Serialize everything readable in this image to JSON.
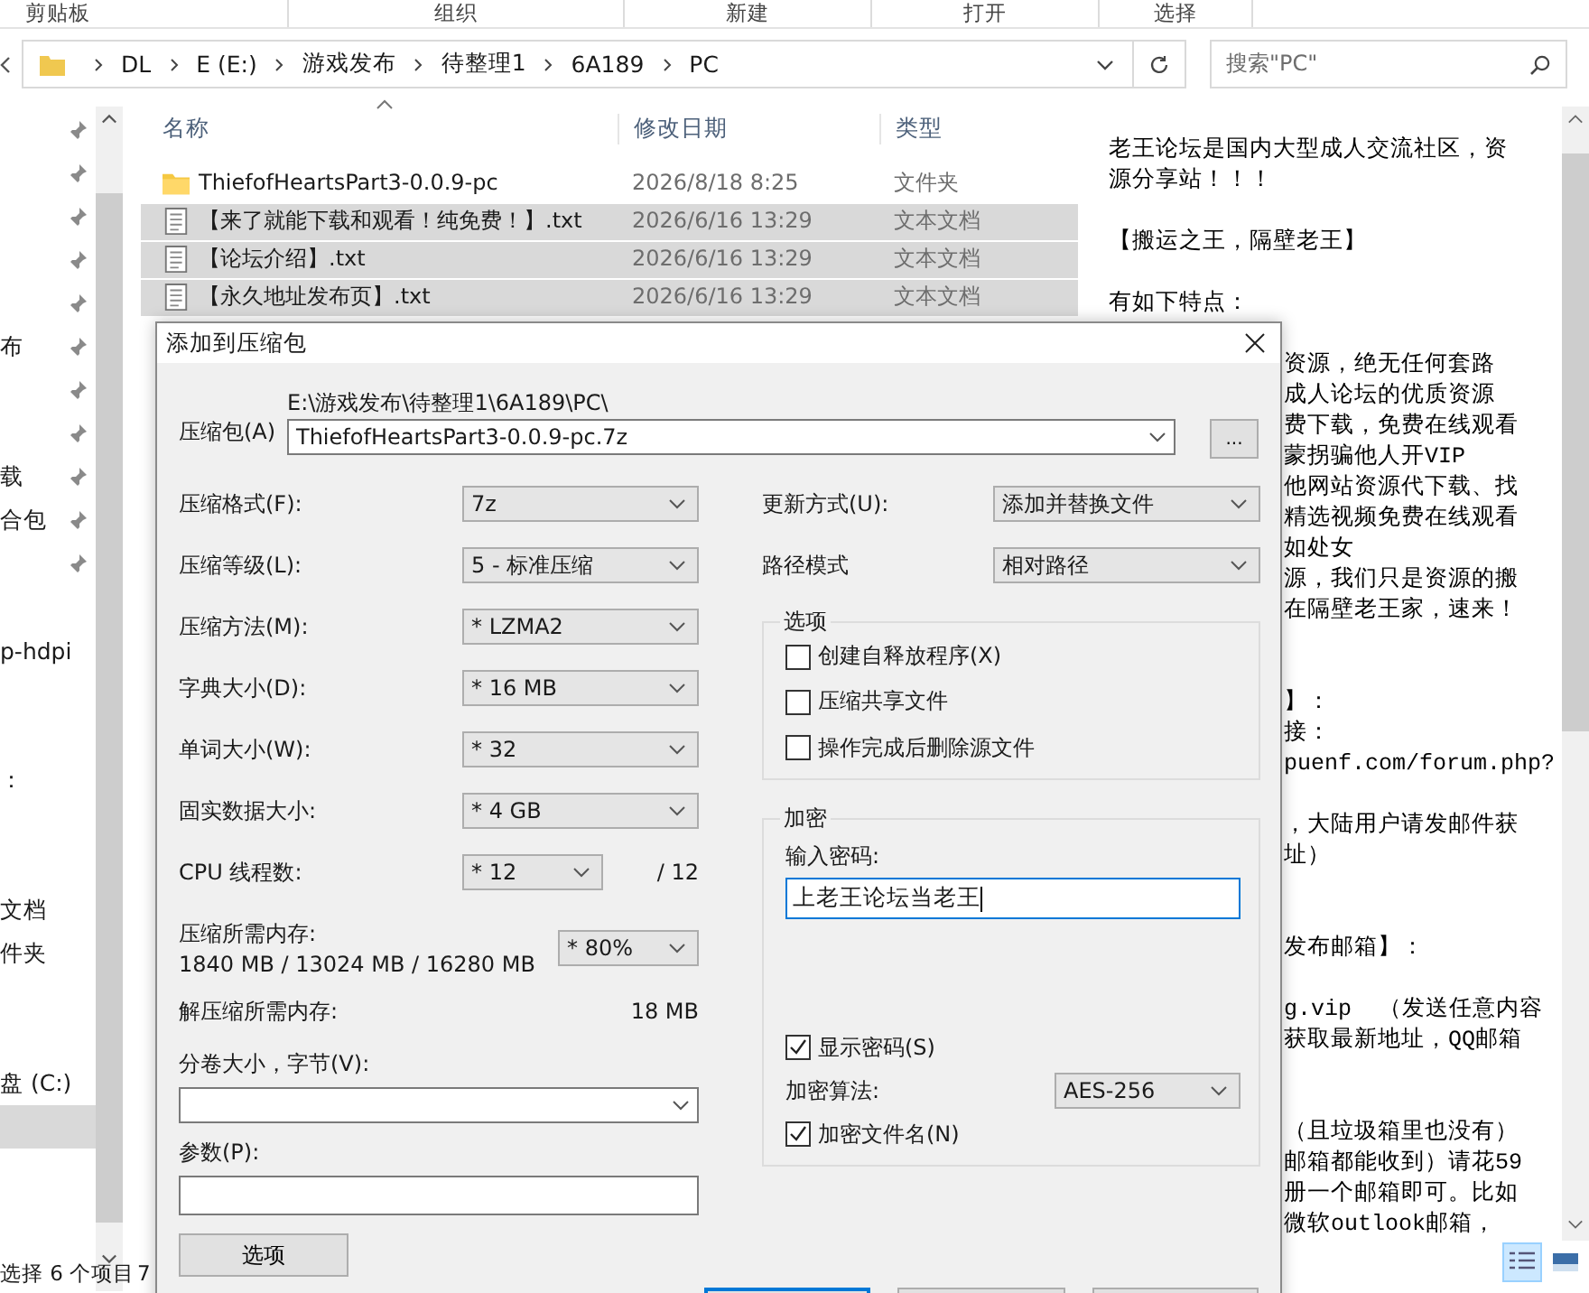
{
  "ribbon_groups": [
    "剪贴板",
    "组织",
    "新建",
    "打开",
    "选择"
  ],
  "address_bar": {
    "crumbs": [
      "DL",
      "E (E:)",
      "游戏发布",
      "待整理1",
      "6A189",
      "PC"
    ]
  },
  "search": {
    "placeholder": "搜索\"PC\""
  },
  "nav_pane": {
    "items": [
      {
        "pinned": true,
        "selected": false
      },
      {
        "pinned": true,
        "selected": false
      },
      {
        "pinned": true,
        "selected": false
      },
      {
        "pinned": true,
        "selected": false
      },
      {
        "pinned": true,
        "selected": false
      },
      {
        "pinned": true,
        "label": "布",
        "selected": false
      },
      {
        "pinned": true,
        "selected": false
      },
      {
        "pinned": true,
        "selected": false
      },
      {
        "pinned": true,
        "label": "载",
        "selected": false
      },
      {
        "pinned": true,
        "label": "合包",
        "selected": false
      },
      {
        "pinned": true,
        "selected": false
      },
      {
        "pinned": false,
        "selected": false
      },
      {
        "pinned": false,
        "label": "p-hdpi",
        "selected": false
      },
      {
        "pinned": false,
        "selected": false
      },
      {
        "pinned": false,
        "selected": false
      },
      {
        "pinned": false,
        "label": "：",
        "selected": false
      },
      {
        "pinned": false,
        "selected": false
      },
      {
        "pinned": false,
        "selected": false
      },
      {
        "pinned": false,
        "label": "文档",
        "selected": false
      },
      {
        "pinned": false,
        "label": "件夹",
        "selected": false
      },
      {
        "pinned": false,
        "selected": false
      },
      {
        "pinned": false,
        "selected": false
      },
      {
        "pinned": false,
        "label": "盘 (C:)",
        "selected": false
      },
      {
        "pinned": false,
        "selected": true
      }
    ]
  },
  "file_list": {
    "columns": [
      "名称",
      "修改日期",
      "类型"
    ],
    "rows": [
      {
        "kind": "folder",
        "name": "ThiefofHeartsPart3-0.0.9-pc",
        "modified": "2026/8/18 8:25",
        "type": "文件夹",
        "selected": false
      },
      {
        "kind": "text",
        "name": "【来了就能下载和观看！纯免费！】.txt",
        "modified": "2026/6/16 13:29",
        "type": "文本文档",
        "selected": true
      },
      {
        "kind": "text",
        "name": "【论坛介绍】.txt",
        "modified": "2026/6/16 13:29",
        "type": "文本文档",
        "selected": true
      },
      {
        "kind": "text",
        "name": "【永久地址发布页】.txt",
        "modified": "2026/6/16 13:29",
        "type": "文本文档",
        "selected": true
      }
    ]
  },
  "preview": {
    "lines": [
      {
        "kind": "full",
        "text": "老王论坛是国内大型成人交流社区，资"
      },
      {
        "kind": "full",
        "text": "源分享站！！！"
      },
      {
        "kind": "blank"
      },
      {
        "kind": "full",
        "text": "【搬运之王，隔壁老王】"
      },
      {
        "kind": "blank"
      },
      {
        "kind": "full",
        "text": "有如下特点："
      },
      {
        "kind": "blank"
      },
      {
        "kind": "cut",
        "text": "资源，绝无任何套路"
      },
      {
        "kind": "cut",
        "text": "成人论坛的优质资源"
      },
      {
        "kind": "cut",
        "text": "费下载，免费在线观看"
      },
      {
        "kind": "cut",
        "text": "蒙拐骗他人开VIP"
      },
      {
        "kind": "cut",
        "text": "他网站资源代下载、找"
      },
      {
        "kind": "cut",
        "text": "精选视频免费在线观看"
      },
      {
        "kind": "cut",
        "text": "如处女"
      },
      {
        "kind": "cut",
        "text": "源，我们只是资源的搬"
      },
      {
        "kind": "cut",
        "text": "在隔壁老王家，速来！"
      },
      {
        "kind": "blank"
      },
      {
        "kind": "blank"
      },
      {
        "kind": "cut",
        "text": "】："
      },
      {
        "kind": "cut",
        "text": "接："
      },
      {
        "kind": "cut",
        "text": "puenf.com/forum.php?"
      },
      {
        "kind": "blank"
      },
      {
        "kind": "cut",
        "text": "，大陆用户请发邮件获"
      },
      {
        "kind": "cut",
        "text": "址）"
      },
      {
        "kind": "blank"
      },
      {
        "kind": "blank"
      },
      {
        "kind": "cut",
        "text": "发布邮箱】："
      },
      {
        "kind": "blank"
      },
      {
        "kind": "cut",
        "text": "g.vip  （发送任意内容"
      },
      {
        "kind": "cut",
        "text": "获取最新地址，QQ邮箱"
      },
      {
        "kind": "blank"
      },
      {
        "kind": "blank"
      },
      {
        "kind": "cut",
        "text": "（且垃圾箱里也没有）"
      },
      {
        "kind": "cut",
        "text": "邮箱都能收到）请花59"
      },
      {
        "kind": "cut",
        "text": "册一个邮箱即可。比如"
      },
      {
        "kind": "cut",
        "text": "微软outlook邮箱，"
      }
    ],
    "views": [
      {
        "selected": true
      },
      {
        "selected": false
      }
    ]
  },
  "status_bar": {
    "text": "选择 6 个项目",
    "cut_text": "7"
  },
  "dialog": {
    "title": "添加到压缩包",
    "archive": {
      "label": "压缩包(A)",
      "folder": "E:\\游戏发布\\待整理1\\6A189\\PC\\",
      "value": "ThiefofHeartsPart3-0.0.9-pc.7z",
      "browse": "..."
    },
    "left_fields": [
      {
        "kind": "select",
        "label": "压缩格式(F):",
        "value": "7z"
      },
      {
        "kind": "select",
        "label": "压缩等级(L):",
        "value": "5 - 标准压缩"
      },
      {
        "kind": "select",
        "label": "压缩方法(M):",
        "value": "* LZMA2"
      },
      {
        "kind": "select",
        "label": "字典大小(D):",
        "value": "* 16 MB"
      },
      {
        "kind": "select",
        "label": "单词大小(W):",
        "value": "* 32"
      },
      {
        "kind": "select",
        "label": "固实数据大小:",
        "value": "* 4 GB"
      },
      {
        "kind": "threads",
        "label": "CPU 线程数:",
        "value": "* 12",
        "suffix": "/ 12"
      },
      {
        "kind": "memory",
        "label": "压缩所需内存:",
        "detail": "1840 MB / 13024 MB / 16280 MB",
        "value": "* 80%"
      },
      {
        "kind": "info",
        "label": "解压缩所需内存:",
        "value": "18 MB"
      },
      {
        "kind": "combo",
        "label": "分卷大小，字节(V):"
      },
      {
        "kind": "input",
        "label": "参数(P):"
      }
    ],
    "options_button": "选项",
    "right_fields": [
      {
        "label": "更新方式(U):",
        "value": "添加并替换文件"
      },
      {
        "label": "路径模式",
        "value": "相对路径"
      }
    ],
    "options_group": {
      "title": "选项",
      "checkboxes": [
        {
          "label": "创建自释放程序(X)",
          "checked": false
        },
        {
          "label": "压缩共享文件",
          "checked": false
        },
        {
          "label": "操作完成后删除源文件",
          "checked": false
        }
      ]
    },
    "encryption": {
      "title": "加密",
      "password_label": "输入密码:",
      "password": "上老王论坛当老王",
      "show_password": {
        "label": "显示密码(S)",
        "checked": true
      },
      "method_label": "加密算法:",
      "method": "AES-256",
      "encrypt_names": {
        "label": "加密文件名(N)",
        "checked": true
      }
    },
    "bottom_buttons": [
      {
        "default": true
      },
      {
        "default": false
      },
      {
        "default": false
      }
    ]
  }
}
